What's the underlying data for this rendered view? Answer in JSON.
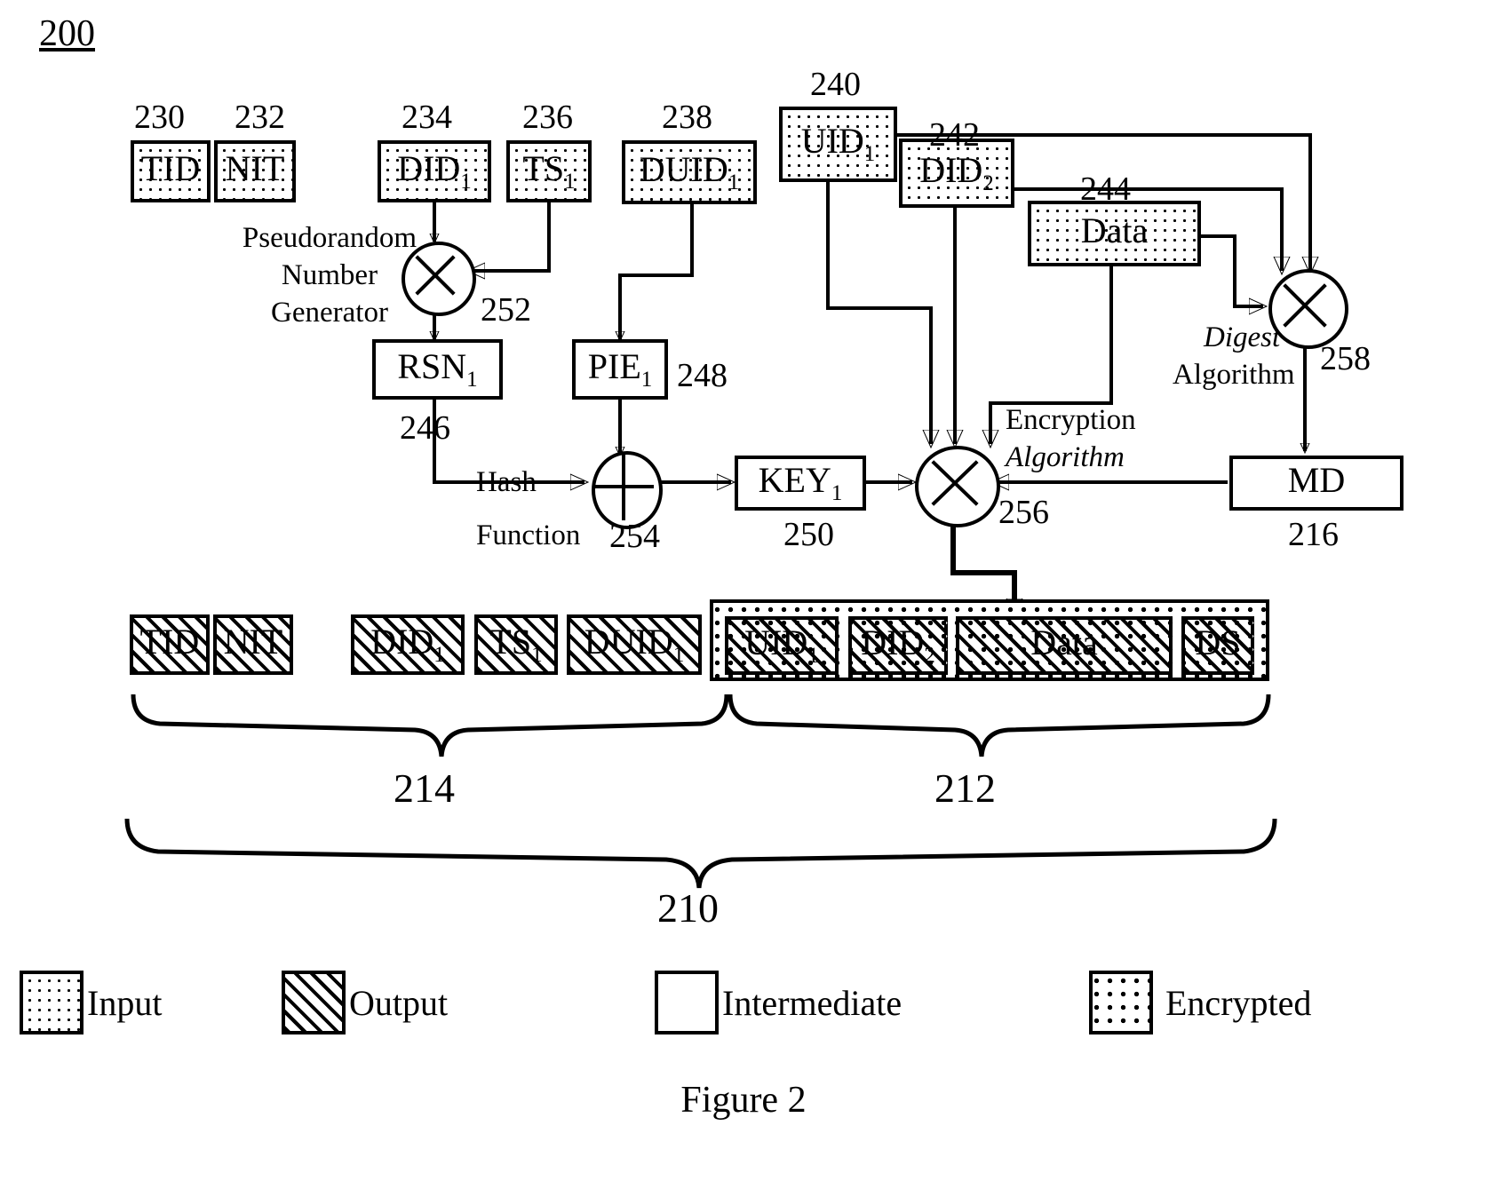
{
  "figure": {
    "page_number": "200",
    "caption": "Figure 2"
  },
  "inputs": [
    {
      "id": "230",
      "label": "TID",
      "sub": "",
      "type": "input"
    },
    {
      "id": "232",
      "label": "NIT",
      "sub": "",
      "type": "input"
    },
    {
      "id": "234",
      "label": "DID",
      "sub": "1",
      "type": "input"
    },
    {
      "id": "236",
      "label": "TS",
      "sub": "1",
      "type": "input"
    },
    {
      "id": "238",
      "label": "DUID",
      "sub": "1",
      "type": "input"
    },
    {
      "id": "240",
      "label": "UID",
      "sub": "1",
      "type": "input"
    },
    {
      "id": "242",
      "label": "DID",
      "sub": "2",
      "type": "input"
    },
    {
      "id": "244",
      "label": "Data",
      "sub": "",
      "type": "input"
    }
  ],
  "intermediates": [
    {
      "id": "246",
      "label": "RSN",
      "sub": "1",
      "type": "intermediate"
    },
    {
      "id": "248",
      "label": "PIE",
      "sub": "1",
      "type": "intermediate"
    },
    {
      "id": "250",
      "label": "KEY",
      "sub": "1",
      "type": "intermediate"
    },
    {
      "id": "216",
      "label": "MD",
      "sub": "",
      "type": "intermediate"
    }
  ],
  "operators": [
    {
      "id": "252",
      "name": "Pseudorandom Number Generator",
      "glyph": "cross-circle"
    },
    {
      "id": "254",
      "name": "Hash Function",
      "glyph": "plus-circle"
    },
    {
      "id": "256",
      "name": "Encryption Algorithm",
      "glyph": "cross-circle"
    },
    {
      "id": "258",
      "name": "Digest Algorithm",
      "glyph": "cross-circle"
    }
  ],
  "operator_labels": {
    "prng_line1": "Pseudorandom",
    "prng_line2": "Number",
    "prng_line3": "Generator",
    "hash_line1": "Hash",
    "hash_line2": "Function",
    "encryption_line1": "Encryption",
    "encryption_line2": "Algorithm",
    "digest_line1": "Digest",
    "digest_line2": "Algorithm"
  },
  "packet": {
    "id": "210",
    "cleartext": {
      "id": "214",
      "fields": [
        {
          "label": "TID",
          "sub": ""
        },
        {
          "label": "NIT",
          "sub": ""
        },
        {
          "label": "DID",
          "sub": "1"
        },
        {
          "label": "TS",
          "sub": "1"
        },
        {
          "label": "DUID",
          "sub": "1"
        }
      ]
    },
    "encrypted": {
      "id": "212",
      "fields": [
        {
          "label": "UID",
          "sub": "1"
        },
        {
          "label": "DID",
          "sub": "2"
        },
        {
          "label": "Data",
          "sub": ""
        },
        {
          "label": "DS",
          "sub": ""
        }
      ]
    }
  },
  "legend": [
    {
      "label": "Input",
      "pattern": "dotted"
    },
    {
      "label": "Output",
      "pattern": "hatched"
    },
    {
      "label": "Intermediate",
      "pattern": "plain"
    },
    {
      "label": "Encrypted",
      "pattern": "wavy"
    }
  ]
}
